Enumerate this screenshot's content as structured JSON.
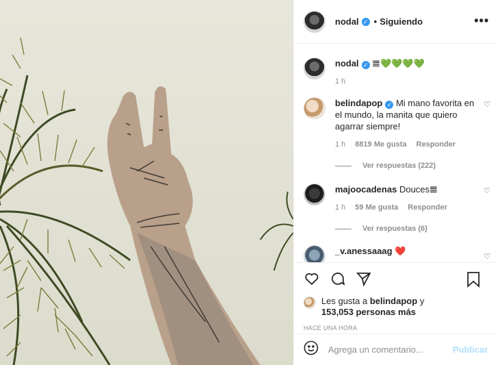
{
  "post": {
    "author": "nodal",
    "follow_status": "Siguiendo",
    "more_icon": "•••"
  },
  "caption": {
    "user": "nodal",
    "text": "𝌆💚💚💚💚",
    "time": "1 h"
  },
  "comments": [
    {
      "user": "belindapop",
      "verified": true,
      "text": "Mi mano favorita en el mundo, la manita que quiero agarrar siempre!",
      "time": "1 h",
      "likes": "8819 Me gusta",
      "reply": "Responder",
      "replies_label": "Ver respuestas (222)"
    },
    {
      "user": "majoocadenas",
      "verified": false,
      "text": "Douces𝌆",
      "time": "1 h",
      "likes": "59 Me gusta",
      "reply": "Responder",
      "replies_label": "Ver respuestas (6)"
    },
    {
      "user": "_v.anessaaag",
      "verified": false,
      "text": "❤️"
    }
  ],
  "actions": {
    "like_icon": "heart-icon",
    "comment_icon": "comment-icon",
    "share_icon": "share-icon",
    "save_icon": "bookmark-icon"
  },
  "liked_by": {
    "prefix": "Les gusta a",
    "user": "belindapop",
    "joiner": "y",
    "others": "153,053 personas más"
  },
  "timestamp": "HACE UNA HORA",
  "add_comment": {
    "placeholder": "Agrega un comentario...",
    "publish": "Publicar"
  },
  "colors": {
    "accent": "#3897f0",
    "publish_disabled": "#b2dffc",
    "muted": "#8e8e8e"
  }
}
